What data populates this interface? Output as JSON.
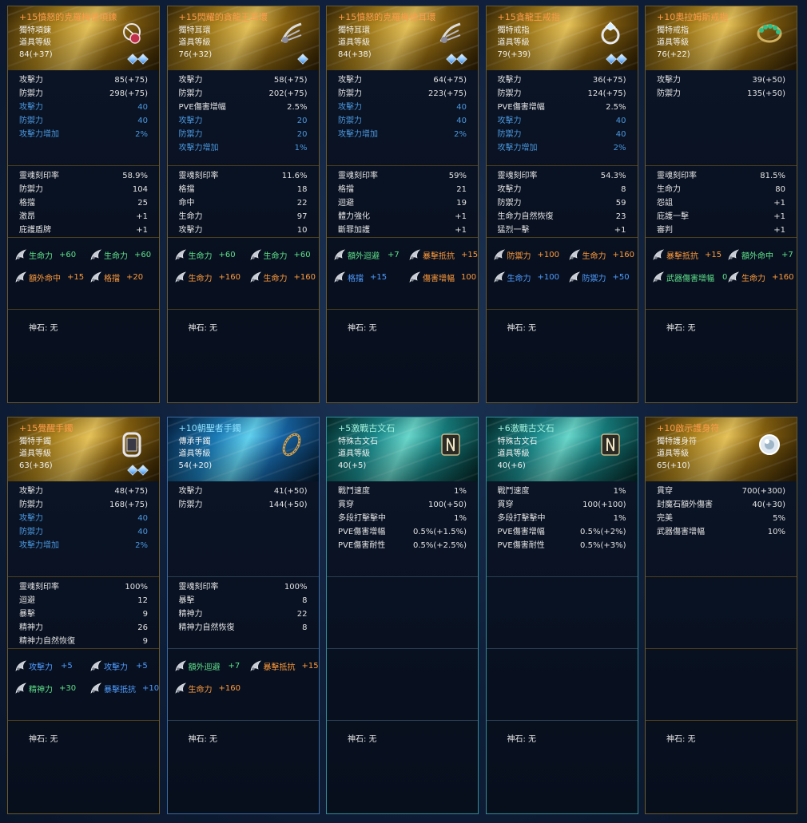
{
  "colors": {
    "orange": "#ff9a4a",
    "blue_stat": "#4a98e0",
    "green_engrave": "#5ee08a",
    "orange_engrave": "#ff9a3a",
    "blue_engrave": "#4f9cff"
  },
  "cards": [
    {
      "name": "+15憤怒的克羅梅德項鍊",
      "name_color": "orange",
      "theme": "gold",
      "border": "gold",
      "type": "獨特項鍊",
      "level_label": "道具等級",
      "level": "84(+37)",
      "gems": 2,
      "icon": "necklace-icon",
      "stats": [
        [
          "攻擊力",
          "85(+75)",
          "w"
        ],
        [
          "防禦力",
          "298(+75)",
          "w"
        ],
        [
          "攻擊力",
          "40",
          "b"
        ],
        [
          "防禦力",
          "40",
          "b"
        ],
        [
          "攻擊力增加",
          "2%",
          "b"
        ]
      ],
      "soul": [
        [
          "靈魂刻印率",
          "58.9%"
        ],
        [
          "防禦力",
          "104"
        ],
        [
          "格擋",
          "25"
        ],
        [
          "激昂",
          "+1"
        ],
        [
          "庇護盾牌",
          "+1"
        ]
      ],
      "engr": [
        [
          [
            "生命力",
            "+60",
            "green"
          ],
          [
            "生命力",
            "+60",
            "green"
          ]
        ],
        [
          [
            "額外命中",
            "+15",
            "orange"
          ],
          [
            "格擋",
            "+20",
            "orange"
          ]
        ]
      ],
      "godstone": "神石: 无"
    },
    {
      "name": "+15閃耀的貪龍王耳環",
      "name_color": "orange",
      "theme": "gold",
      "border": "gold",
      "type": "獨特耳環",
      "level_label": "道具等級",
      "level": "76(+32)",
      "gems": 1,
      "icon": "earring-icon",
      "stats": [
        [
          "攻擊力",
          "58(+75)",
          "w"
        ],
        [
          "防禦力",
          "202(+75)",
          "w"
        ],
        [
          "PVE傷害增幅",
          "2.5%",
          "w"
        ],
        [
          "攻擊力",
          "20",
          "b"
        ],
        [
          "防禦力",
          "20",
          "b"
        ],
        [
          "攻擊力增加",
          "1%",
          "b"
        ]
      ],
      "soul": [
        [
          "靈魂刻印率",
          "11.6%"
        ],
        [
          "格擋",
          "18"
        ],
        [
          "命中",
          "22"
        ],
        [
          "生命力",
          "97"
        ],
        [
          "攻擊力",
          "10"
        ]
      ],
      "engr": [
        [
          [
            "生命力",
            "+60",
            "green"
          ],
          [
            "生命力",
            "+60",
            "green"
          ]
        ],
        [
          [
            "生命力",
            "+160",
            "orange"
          ],
          [
            "生命力",
            "+160",
            "orange"
          ]
        ]
      ],
      "godstone": "神石: 无"
    },
    {
      "name": "+15憤怒的克羅梅德耳環",
      "name_color": "orange",
      "theme": "gold",
      "border": "gold",
      "type": "獨特耳環",
      "level_label": "道具等級",
      "level": "84(+38)",
      "gems": 2,
      "icon": "earring-icon",
      "stats": [
        [
          "攻擊力",
          "64(+75)",
          "w"
        ],
        [
          "防禦力",
          "223(+75)",
          "w"
        ],
        [
          "攻擊力",
          "40",
          "b"
        ],
        [
          "防禦力",
          "40",
          "b"
        ],
        [
          "攻擊力增加",
          "2%",
          "b"
        ]
      ],
      "soul": [
        [
          "靈魂刻印率",
          "59%"
        ],
        [
          "格擋",
          "21"
        ],
        [
          "迴避",
          "19"
        ],
        [
          "體力強化",
          "+1"
        ],
        [
          "斷罪加護",
          "+1"
        ]
      ],
      "engr": [
        [
          [
            "額外迴避",
            "+7",
            "green"
          ],
          [
            "暴擊抵抗",
            "+15",
            "orange"
          ]
        ],
        [
          [
            "格擋",
            "+15",
            "blue"
          ],
          [
            "傷害增幅",
            "100",
            "orange"
          ]
        ]
      ],
      "godstone": "神石: 无"
    },
    {
      "name": "+15貪龍王戒指",
      "name_color": "orange",
      "theme": "gold",
      "border": "gold",
      "type": "獨特戒指",
      "level_label": "道具等級",
      "level": "79(+39)",
      "gems": 2,
      "icon": "ring-icon",
      "stats": [
        [
          "攻擊力",
          "36(+75)",
          "w"
        ],
        [
          "防禦力",
          "124(+75)",
          "w"
        ],
        [
          "PVE傷害增幅",
          "2.5%",
          "w"
        ],
        [
          "攻擊力",
          "40",
          "b"
        ],
        [
          "防禦力",
          "40",
          "b"
        ],
        [
          "攻擊力增加",
          "2%",
          "b"
        ]
      ],
      "soul": [
        [
          "靈魂刻印率",
          "54.3%"
        ],
        [
          "攻擊力",
          "8"
        ],
        [
          "防禦力",
          "59"
        ],
        [
          "生命力自然恢復",
          "23"
        ],
        [
          "猛烈一擊",
          "+1"
        ]
      ],
      "engr": [
        [
          [
            "防禦力",
            "+100",
            "orange"
          ],
          [
            "生命力",
            "+160",
            "orange"
          ]
        ],
        [
          [
            "生命力",
            "+100",
            "blue"
          ],
          [
            "防禦力",
            "+50",
            "blue"
          ]
        ]
      ],
      "godstone": "神石: 无"
    },
    {
      "name": "+10奧拉姆斯戒指",
      "name_color": "orange",
      "theme": "gold",
      "border": "gold",
      "type": "獨特戒指",
      "level_label": "道具等級",
      "level": "76(+22)",
      "gems": 0,
      "icon": "emerald-ring-icon",
      "stats": [
        [
          "攻擊力",
          "39(+50)",
          "w"
        ],
        [
          "防禦力",
          "135(+50)",
          "w"
        ]
      ],
      "soul": [
        [
          "靈魂刻印率",
          "81.5%"
        ],
        [
          "生命力",
          "80"
        ],
        [
          "怨詛",
          "+1"
        ],
        [
          "庇護一擊",
          "+1"
        ],
        [
          "審判",
          "+1"
        ]
      ],
      "engr": [
        [
          [
            "暴擊抵抗",
            "+15",
            "orange"
          ],
          [
            "額外命中",
            "+7",
            "green"
          ]
        ],
        [
          [
            "武器傷害增幅",
            "0",
            "green"
          ],
          [
            "生命力",
            "+160",
            "orange"
          ]
        ]
      ],
      "godstone": "神石: 无"
    },
    {
      "name": "+15覺醒手鐲",
      "name_color": "orange",
      "theme": "gold",
      "border": "gold",
      "type": "獨特手鐲",
      "level_label": "道具等級",
      "level": "63(+36)",
      "gems": 2,
      "icon": "bracelet-icon",
      "stats": [
        [
          "攻擊力",
          "48(+75)",
          "w"
        ],
        [
          "防禦力",
          "168(+75)",
          "w"
        ],
        [
          "攻擊力",
          "40",
          "b"
        ],
        [
          "防禦力",
          "40",
          "b"
        ],
        [
          "攻擊力增加",
          "2%",
          "b"
        ]
      ],
      "soul": [
        [
          "靈魂刻印率",
          "100%"
        ],
        [
          "迴避",
          "12"
        ],
        [
          "暴擊",
          "9"
        ],
        [
          "精神力",
          "26"
        ],
        [
          "精神力自然恢復",
          "9"
        ]
      ],
      "engr": [
        [
          [
            "攻擊力",
            "+5",
            "blue"
          ],
          [
            "攻擊力",
            "+5",
            "blue"
          ]
        ],
        [
          [
            "精神力",
            "+30",
            "green"
          ],
          [
            "暴擊抵抗",
            "+10",
            "blue"
          ]
        ]
      ],
      "godstone": "神石: 无"
    },
    {
      "name": "+10朝聖者手鐲",
      "name_color": "cyan",
      "theme": "blue",
      "border": "blue",
      "type": "傳承手鐲",
      "level_label": "道具等級",
      "level": "54(+20)",
      "gems": 0,
      "icon": "chain-bracelet-icon",
      "stats": [
        [
          "攻擊力",
          "41(+50)",
          "w"
        ],
        [
          "防禦力",
          "144(+50)",
          "w"
        ]
      ],
      "soul": [
        [
          "靈魂刻印率",
          "100%"
        ],
        [
          "暴擊",
          "8"
        ],
        [
          "精神力",
          "22"
        ],
        [
          "精神力自然恢復",
          "8"
        ]
      ],
      "engr": [
        [
          [
            "額外迴避",
            "+7",
            "green"
          ],
          [
            "暴擊抵抗",
            "+15",
            "orange"
          ]
        ],
        [
          [
            "生命力",
            "+160",
            "orange"
          ]
        ]
      ],
      "godstone": "神石: 无"
    },
    {
      "name": "+5激戰古文石",
      "name_color": "teal",
      "theme": "teal",
      "border": "teal",
      "type": "特殊古文石",
      "level_label": "道具等級",
      "level": "40(+5)",
      "gems": 0,
      "icon": "rune-stone-icon",
      "stats": [
        [
          "戰鬥速度",
          "1%",
          "w"
        ],
        [
          "貫穿",
          "100(+50)",
          "w"
        ],
        [
          "多段打擊擊中",
          "1%",
          "w"
        ],
        [
          "PVE傷害增幅",
          "0.5%(+1.5%)",
          "w"
        ],
        [
          "PVE傷害耐性",
          "0.5%(+2.5%)",
          "w"
        ]
      ],
      "soul": [],
      "engr": [],
      "godstone": "神石: 无"
    },
    {
      "name": "+6激戰古文石",
      "name_color": "teal",
      "theme": "teal",
      "border": "teal",
      "type": "特殊古文石",
      "level_label": "道具等級",
      "level": "40(+6)",
      "gems": 0,
      "icon": "rune-stone-icon",
      "stats": [
        [
          "戰鬥速度",
          "1%",
          "w"
        ],
        [
          "貫穿",
          "100(+100)",
          "w"
        ],
        [
          "多段打擊擊中",
          "1%",
          "w"
        ],
        [
          "PVE傷害增幅",
          "0.5%(+2%)",
          "w"
        ],
        [
          "PVE傷害耐性",
          "0.5%(+3%)",
          "w"
        ]
      ],
      "soul": [],
      "engr": [],
      "godstone": "神石: 无"
    },
    {
      "name": "+10啟示護身符",
      "name_color": "orange",
      "theme": "gold",
      "border": "gold",
      "type": "獨特護身符",
      "level_label": "道具等級",
      "level": "65(+10)",
      "gems": 0,
      "icon": "amulet-icon",
      "stats": [
        [
          "貫穿",
          "700(+300)",
          "w"
        ],
        [
          "封魔石額外傷害",
          "40(+30)",
          "w"
        ],
        [
          "完美",
          "5%",
          "w"
        ],
        [
          "武器傷害增幅",
          "10%",
          "w"
        ]
      ],
      "soul": [],
      "engr": [],
      "godstone": "神石: 无"
    }
  ]
}
